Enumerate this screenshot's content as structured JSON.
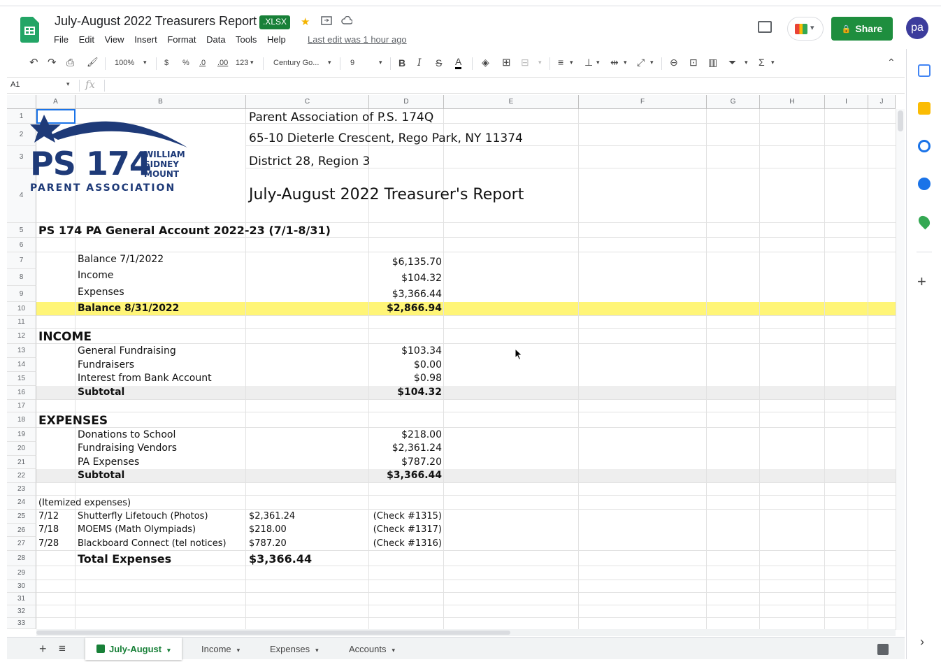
{
  "header": {
    "doc_title": "July-August 2022 Treasurers Report",
    "badge": ".XLSX",
    "star": "★",
    "menu": [
      "File",
      "Edit",
      "View",
      "Insert",
      "Format",
      "Data",
      "Tools",
      "Help"
    ],
    "last_edit": "Last edit was 1 hour ago",
    "share_label": "Share",
    "lock": "🔒",
    "avatar_initials": "pa"
  },
  "toolbar": {
    "zoom": "100%",
    "currency": "$",
    "percent": "%",
    "dec_dec": ".0",
    "dec_inc": ".00",
    "format_more": "123",
    "font": "Century Go...",
    "font_size": "9",
    "bold": "B",
    "italic": "I",
    "strike": "S",
    "text_color": "A",
    "sum": "Σ"
  },
  "formula_bar": {
    "name_box": "A1",
    "fx": "fx"
  },
  "columns": [
    "A",
    "B",
    "C",
    "D",
    "E",
    "F",
    "G",
    "H",
    "I",
    "J"
  ],
  "rows": [
    "1",
    "2",
    "3",
    "4",
    "5",
    "6",
    "7",
    "8",
    "9",
    "10",
    "11",
    "12",
    "13",
    "14",
    "15",
    "16",
    "17",
    "18",
    "19",
    "20",
    "21",
    "22",
    "23",
    "24",
    "25",
    "26",
    "27",
    "28",
    "29",
    "30",
    "31",
    "32",
    "33"
  ],
  "logo": {
    "big": "PS 174",
    "line1": "WILLIAM",
    "line2": "SIDNEY",
    "line3": "MOUNT",
    "sub": "PARENT ASSOCIATION",
    "navy": "#1e3a78"
  },
  "cells": {
    "c1": "Parent Association of P.S. 174Q",
    "c2": "65-10 Dieterle Crescent, Rego Park, NY 11374",
    "c3": "District 28, Region 3",
    "c4": "July-August 2022 Treasurer's Report",
    "a5": "PS 174 PA General Account 2022-23 (7/1-8/31)",
    "b7": "Balance 7/1/2022",
    "d7": "$6,135.70",
    "b8": "Income",
    "d8": "$104.32",
    "b9": "Expenses",
    "d9": "$3,366.44",
    "b10": "Balance 8/31/2022",
    "d10": "$2,866.94",
    "a12": "INCOME",
    "b13": "General Fundraising",
    "d13": "$103.34",
    "b14": "Fundraisers",
    "d14": "$0.00",
    "b15": "Interest from Bank Account",
    "d15": "$0.98",
    "b16": "Subtotal",
    "d16": "$104.32",
    "a18": "EXPENSES",
    "b19": "Donations to School",
    "d19": "$218.00",
    "b20": "Fundraising Vendors",
    "d20": "$2,361.24",
    "b21": "PA Expenses",
    "d21": "$787.20",
    "b22": "Subtotal",
    "d22": "$3,366.44",
    "a24": "(Itemized expenses)",
    "a25": "7/12",
    "b25": "Shutterfly Lifetouch (Photos)",
    "c25": "$2,361.24",
    "d25": "(Check #1315)",
    "a26": "7/18",
    "b26": "MOEMS (Math Olympiads)",
    "c26": "$218.00",
    "d26": "(Check #1317)",
    "a27": "7/28",
    "b27": "Blackboard Connect (tel notices)",
    "c27": "$787.20",
    "d27": "(Check #1316)",
    "b28": "Total Expenses",
    "c28": "$3,366.44"
  },
  "tabs": {
    "add": "+",
    "list": "≡",
    "active": "July-August",
    "t2": "Income",
    "t3": "Expenses",
    "t4": "Accounts"
  },
  "side": {
    "add": "+",
    "collapse": "›"
  },
  "colors": {
    "highlight": "#fff577",
    "share_green": "#1e8e3e",
    "sheets_green": "#23a566"
  }
}
